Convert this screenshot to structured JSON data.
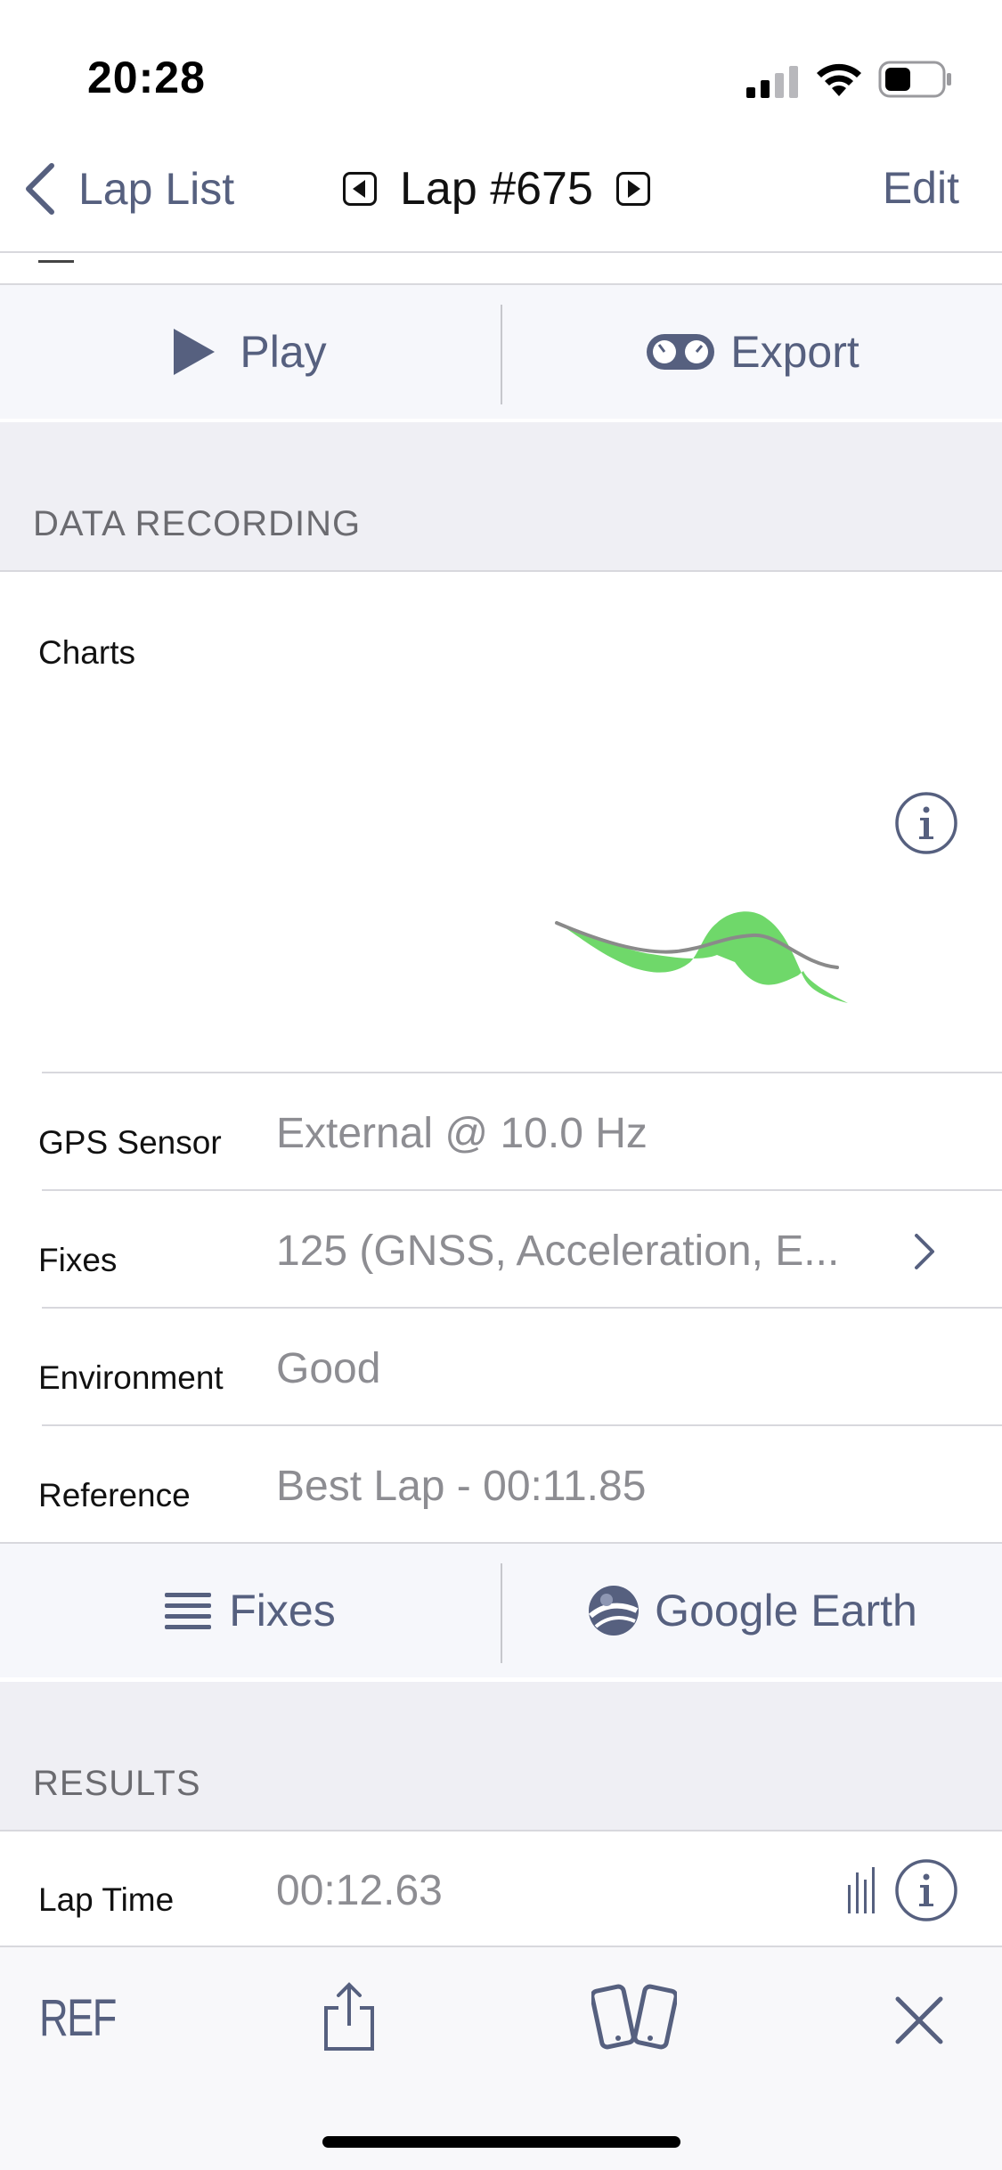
{
  "status": {
    "time": "20:28"
  },
  "nav": {
    "back_label": "Lap List",
    "title": "Lap #675",
    "edit_label": "Edit"
  },
  "actions": {
    "play_label": "Play",
    "export_label": "Export"
  },
  "data_recording": {
    "section_title": "DATA RECORDING",
    "charts_label": "Charts",
    "rows": [
      {
        "label": "GPS Sensor",
        "value": "External @ 10.0 Hz"
      },
      {
        "label": "Fixes",
        "value": "125 (GNSS, Acceleration, E..."
      },
      {
        "label": "Environment",
        "value": "Good"
      },
      {
        "label": "Reference",
        "value": "Best Lap - 00:11.85"
      }
    ]
  },
  "tools": {
    "fixes_label": "Fixes",
    "earth_label": "Google Earth"
  },
  "results": {
    "section_title": "RESULTS",
    "lap_time_label": "Lap Time",
    "lap_time_value": "00:12.63"
  },
  "toolbar": {
    "ref_label": "REF"
  },
  "colors": {
    "accent": "#56607f",
    "chart_fill": "#6fd86a",
    "chart_line": "#8a8a8a"
  }
}
